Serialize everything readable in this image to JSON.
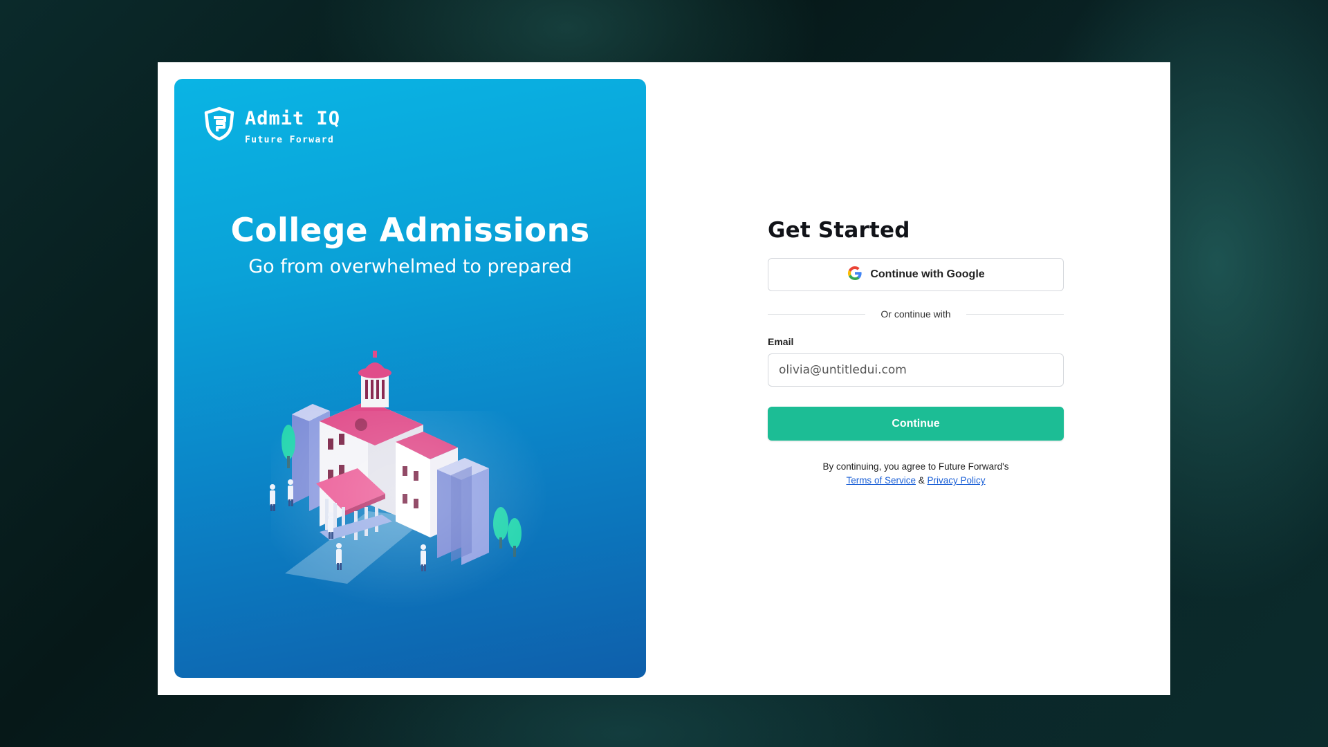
{
  "brand": {
    "name": "Admit IQ",
    "tagline": "Future Forward"
  },
  "hero": {
    "title": "College Admissions",
    "subtitle": "Go from overwhelmed to prepared"
  },
  "form": {
    "title": "Get Started",
    "google_button_label": "Continue with Google",
    "divider_text": "Or continue with",
    "email_label": "Email",
    "email_placeholder": "olivia@untitledui.com",
    "continue_label": "Continue",
    "terms_prefix": "By continuing, you agree to Future Forward's",
    "terms_link": "Terms of Service",
    "terms_joiner": "&",
    "privacy_link": "Privacy Policy"
  },
  "colors": {
    "accent": "#1cbd95",
    "hero_gradient_top": "#0ab4e4",
    "hero_gradient_bottom": "#0e5fab",
    "link": "#1a5fd6"
  },
  "icons": [
    "shield-logo-icon",
    "google-icon",
    "college-illustration"
  ]
}
